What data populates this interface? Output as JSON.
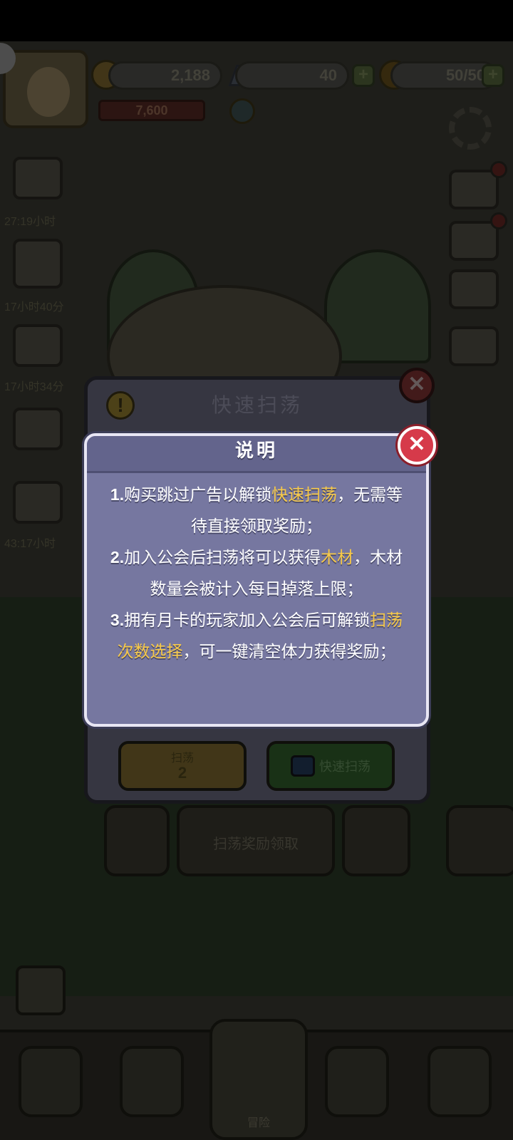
{
  "hud": {
    "coins": "2,188",
    "gems": "40",
    "energy": "50/50",
    "xp_value": "7,600",
    "plus_label": "+"
  },
  "side_timers": [
    {
      "label": "27:19小时"
    },
    {
      "label": "17小时40分"
    },
    {
      "label": "17小时34分"
    },
    {
      "label": "43:17小时"
    }
  ],
  "back_dialog": {
    "title": "快速扫荡",
    "alert_glyph": "!",
    "close_glyph": "✕",
    "left_button_label": "扫荡",
    "left_button_cost": "2",
    "right_button_label": "快速扫荡"
  },
  "dock": {
    "center_label": "扫荡奖励领取"
  },
  "bottom_nav": {
    "center_tab_label": "冒险"
  },
  "info_dialog": {
    "title": "说明",
    "close_glyph": "✕",
    "items": [
      {
        "num": "1.",
        "before": "购买跳过广告以解锁",
        "highlight": "快速扫荡",
        "after": "，无需等待直接领取奖励；"
      },
      {
        "num": "2.",
        "before": "加入公会后扫荡将可以获得",
        "highlight": "木材",
        "after": "，木材数量会被计入每日掉落上限；"
      },
      {
        "num": "3.",
        "before": "拥有月卡的玩家加入公会后可解锁",
        "highlight": "扫荡次数选择",
        "after": "，可一键清空体力获得奖励；"
      }
    ]
  },
  "colors": {
    "dialog_bg": "#7677a0",
    "highlight": "#f7c948",
    "close_red": "#d63a4a"
  }
}
